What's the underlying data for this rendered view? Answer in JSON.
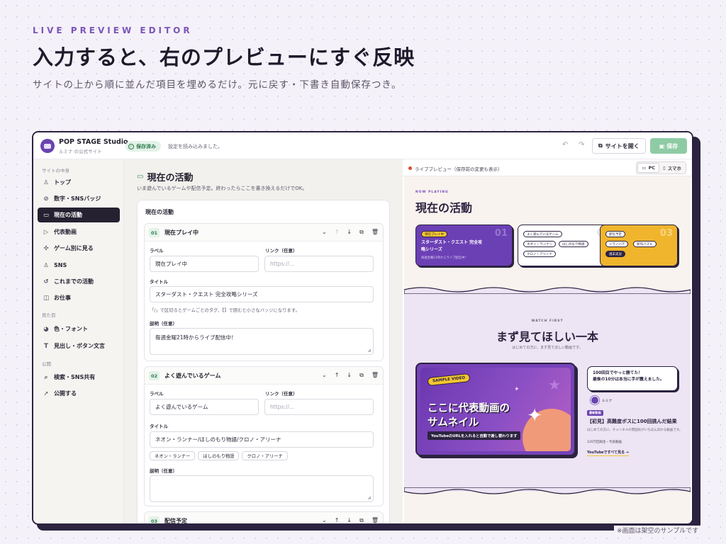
{
  "hero": {
    "eyebrow": "LIVE PREVIEW EDITOR",
    "headline": "入力すると、右のプレビューにすぐ反映",
    "subline": "サイトの上から順に並んだ項目を埋めるだけ。元に戻す・下書き自動保存つき。"
  },
  "topbar": {
    "brand": "POP STAGE Studio",
    "brand_sub": "ルミナ の公式サイト",
    "saved_badge": "保存済み",
    "status_message": "設定を読み込みました。",
    "undo_icon": "undo-icon",
    "redo_icon": "redo-icon",
    "open_site_label": "サイトを開く",
    "save_label": "保存"
  },
  "sidebar": {
    "section_content": "サイトの中身",
    "section_look": "見た目",
    "section_publish": "公開",
    "items": [
      {
        "label": "トップ",
        "icon": "person-icon"
      },
      {
        "label": "数字・SNSバッジ",
        "icon": "check-circle-icon"
      },
      {
        "label": "現在の活動",
        "icon": "gamepad-icon"
      },
      {
        "label": "代表動画",
        "icon": "play-circle-icon"
      },
      {
        "label": "ゲーム別に見る",
        "icon": "puzzle-icon"
      },
      {
        "label": "SNS",
        "icon": "user-icon"
      },
      {
        "label": "これまでの活動",
        "icon": "history-icon"
      },
      {
        "label": "お仕事",
        "icon": "briefcase-icon"
      },
      {
        "label": "色・フォント",
        "icon": "palette-icon"
      },
      {
        "label": "見出し・ボタン文言",
        "icon": "text-icon"
      },
      {
        "label": "検索・SNS共有",
        "icon": "search-icon"
      },
      {
        "label": "公開する",
        "icon": "rocket-icon"
      }
    ]
  },
  "editor": {
    "title": "現在の活動",
    "description": "いま遊んでいるゲームや配信予定。終わったらここを書き換えるだけでOK。",
    "card_heading": "現在の活動",
    "label_label": "ラベル",
    "link_label": "リンク（任意）",
    "title_label": "タイトル",
    "desc_label": "説明（任意）",
    "link_placeholder": "https://...",
    "items": [
      {
        "num": "01",
        "heading": "現在プレイ中",
        "label": "現在プレイ中",
        "title": "スターダスト・クエスト 完全攻略シリーズ",
        "hint": "「/」で区切るとゲームごとのタグ、【】で囲むと小さなバッジになります。",
        "description": "毎週金曜21時からライブ配信中！"
      },
      {
        "num": "02",
        "heading": "よく遊んでいるゲーム",
        "label": "よく遊んでいるゲーム",
        "title": "ネオン・ランナー/ほしのもり物語/クロノ・アリーナ",
        "chips": [
          "ネオン・ランナー",
          "ほしのもり物語",
          "クロノ・アリーナ"
        ],
        "description": ""
      },
      {
        "num": "03",
        "heading": "配信予定"
      }
    ]
  },
  "preview": {
    "label": "ライブプレビュー（保存前の変更も表示）",
    "pc_label": "PC",
    "mobile_label": "スマホ",
    "now_playing": "NOW PLAYING",
    "section_title": "現在の活動",
    "cards": [
      {
        "num": "01",
        "badge": "現在プレイ中",
        "title": "スターダスト・クエスト 完全攻",
        "title2": "略シリーズ",
        "sub": "毎週金曜21時からライブ配信中！",
        "color": "#6c40b5"
      },
      {
        "num": "02",
        "tags": [
          "よく遊んでいるゲーム",
          "ネオン・ランナー",
          "ほしのもり物語",
          "クロノ・アリーナ"
        ],
        "color": "#ffffff"
      },
      {
        "num": "03",
        "tags": [
          "配信予定",
          "ソラノハテ",
          "新作パズル",
          "週末実況"
        ],
        "color": "#f0b52d"
      }
    ],
    "watch_first": "WATCH FIRST",
    "feature_title": "まず見てほしい一本",
    "feature_sub": "はじめての方に、まず見てほしい動画です。",
    "sample_badge": "SAMPLE VIDEO",
    "thumb_line1": "ここに代表動画の",
    "thumb_line2": "サムネイル",
    "yt_tag": "YouTubeのURLを入れると自動で差し替わります",
    "bubble_line1": "100回目でやっと勝てた！",
    "bubble_line2": "最後の10分は本当に手が震えました。",
    "avatar_name": "ルミナ",
    "latest_badge": "最新動画",
    "video_title": "【初見】高難度ボスに100回挑んだ結果",
    "video_desc": "はじめての方に、チャンネルの雰囲気がいちばん伝わる動画です。",
    "video_meta": "120万回再生・代表動画",
    "video_link": "YouTubeですべて見る →"
  },
  "footnote": "※画面は架空のサンプルです"
}
